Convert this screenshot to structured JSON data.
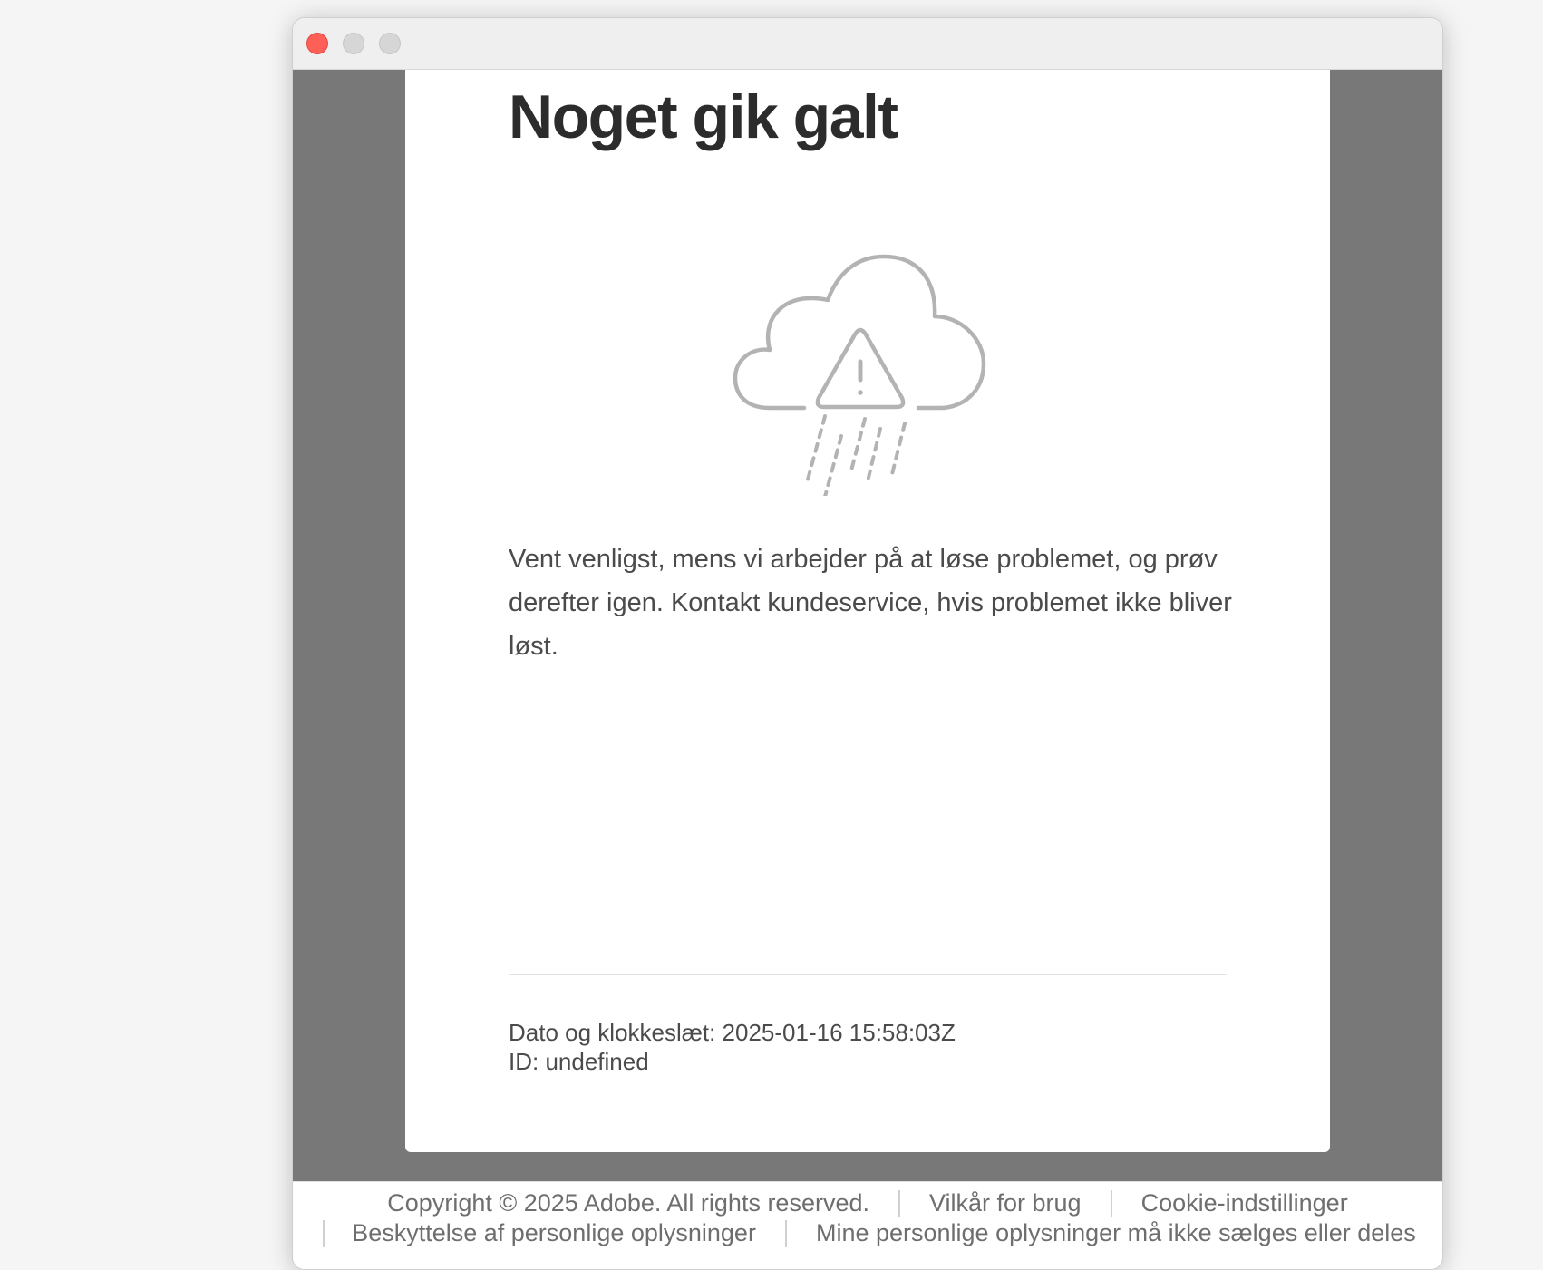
{
  "window": {
    "controls": [
      "close",
      "minimize",
      "maximize"
    ]
  },
  "error": {
    "title": "Noget gik galt",
    "illustration_icon": "cloud-rain-warning-icon",
    "message": "Vent venligst, mens vi arbejder på at løse problemet, og prøv derefter igen. Kontakt kundeservice, hvis problemet ikke bliver løst.",
    "timestamp": "Dato og klokkeslæt: 2025-01-16 15:58:03Z",
    "id": "ID: undefined"
  },
  "footer": {
    "copyright": "Copyright © 2025 Adobe. All rights reserved.",
    "terms": "Vilkår for brug",
    "cookies": "Cookie-indstillinger",
    "privacy": "Beskyttelse af personlige oplysninger",
    "do_not_sell": "Mine personlige oplysninger må ikke sælges eller deles"
  },
  "colors": {
    "close_button": "#fe5f57",
    "backdrop": "#787878",
    "title_text": "#2c2c2c",
    "icon_stroke": "#b3b3b3"
  }
}
